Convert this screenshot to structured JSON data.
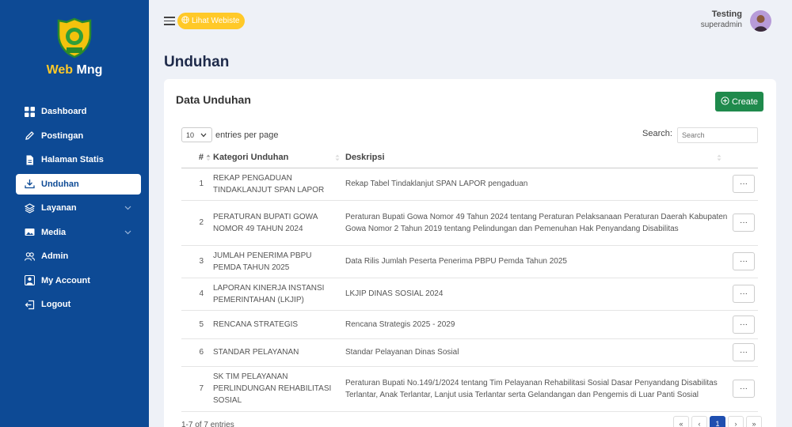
{
  "sidebar": {
    "brand_part1": "Web",
    "brand_part2": "Mng",
    "logo_text": "GOWA",
    "items": [
      {
        "label": "Dashboard"
      },
      {
        "label": "Postingan"
      },
      {
        "label": "Halaman Statis"
      },
      {
        "label": "Unduhan"
      },
      {
        "label": "Layanan"
      },
      {
        "label": "Media"
      },
      {
        "label": "Admin"
      },
      {
        "label": "My Account"
      },
      {
        "label": "Logout"
      }
    ]
  },
  "topbar": {
    "website_button": "Lihat Webiste",
    "user_name": "Testing",
    "user_role": "superadmin"
  },
  "page": {
    "title": "Unduhan"
  },
  "card": {
    "title": "Data Unduhan",
    "create_label": "Create"
  },
  "table_controls": {
    "length_value": "10",
    "length_suffix": "entries per page",
    "search_label": "Search:",
    "search_placeholder": "Search"
  },
  "table": {
    "headers": [
      "#",
      "Kategori Unduhan",
      "Deskripsi"
    ],
    "action_label": "···",
    "rows": [
      {
        "no": "1",
        "kategori": "REKAP PENGADUAN TINDAKLANJUT SPAN LAPOR",
        "deskripsi": "Rekap Tabel Tindaklanjut SPAN LAPOR pengaduan"
      },
      {
        "no": "2",
        "kategori": "PERATURAN BUPATI GOWA NOMOR 49 TAHUN 2024",
        "deskripsi": "Peraturan Bupati Gowa Nomor 49 Tahun 2024 tentang Peraturan Pelaksanaan Peraturan Daerah Kabupaten Gowa Nomor 2 Tahun 2019 tentang Pelindungan dan Pemenuhan Hak Penyandang Disabilitas"
      },
      {
        "no": "3",
        "kategori": "JUMLAH PENERIMA PBPU PEMDA TAHUN 2025",
        "deskripsi": "Data Rilis Jumlah Peserta Penerima PBPU Pemda Tahun 2025"
      },
      {
        "no": "4",
        "kategori": "LAPORAN KINERJA INSTANSI PEMERINTAHAN (LKJIP)",
        "deskripsi": "LKJIP DINAS SOSIAL 2024"
      },
      {
        "no": "5",
        "kategori": "RENCANA STRATEGIS",
        "deskripsi": "Rencana Strategis 2025 - 2029"
      },
      {
        "no": "6",
        "kategori": "STANDAR PELAYANAN",
        "deskripsi": "Standar Pelayanan Dinas Sosial"
      },
      {
        "no": "7",
        "kategori": "SK TIM PELAYANAN PERLINDUNGAN REHABILITASI SOSIAL",
        "deskripsi": "Peraturan Bupati No.149/1/2024 tentang Tim Pelayanan Rehabilitasi Sosial Dasar Penyandang Disabilitas Terlantar, Anak Terlantar, Lanjut usia Terlantar serta Gelandangan dan Pengemis di Luar Panti Sosial"
      }
    ]
  },
  "footer": {
    "info": "1-7 of 7 entries",
    "pages": [
      "«",
      "‹",
      "1",
      "›",
      "»"
    ],
    "current_page": "1"
  },
  "colors": {
    "sidebar": "#0d4a95",
    "brand_accent": "#ffc928",
    "create_button": "#1f8a4c",
    "pager_active": "#1f4fb0"
  }
}
